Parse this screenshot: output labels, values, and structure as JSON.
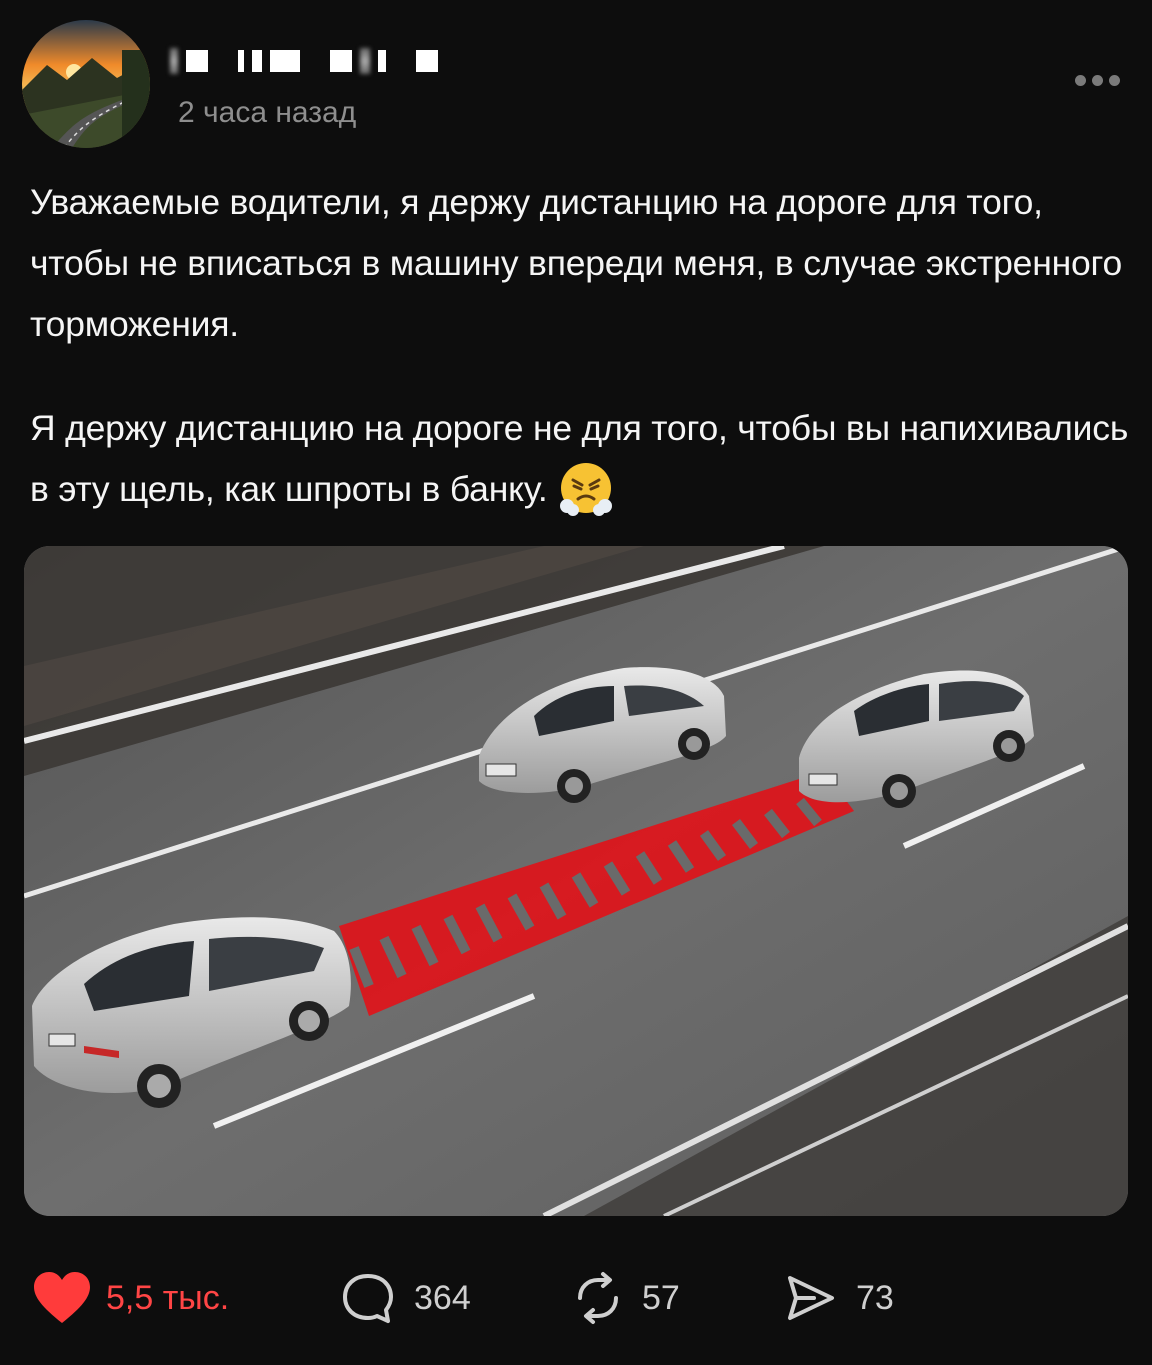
{
  "post": {
    "author": {
      "name_redacted": true
    },
    "timestamp": "2 часа назад",
    "paragraphs": [
      "Уважаемые водители, я держу дистанцию на дороге для того, чтобы не вписаться в машину впереди меня, в случае экстренного торможения.",
      "Я держу дистанцию на дороге не для того, чтобы вы напихивались в эту щель, как шпроты в банку."
    ],
    "emoji": "angry-steam-face"
  },
  "actions": {
    "likes": "5,5 тыс.",
    "comments": "364",
    "reposts": "57",
    "shares": "73"
  },
  "colors": {
    "background": "#0d0d0d",
    "like_red": "#ff3b3b",
    "muted": "#8e8e8e",
    "stripe_red": "#e0141a"
  },
  "icons": [
    "more-icon",
    "heart-icon",
    "comment-icon",
    "repost-icon",
    "share-icon"
  ]
}
